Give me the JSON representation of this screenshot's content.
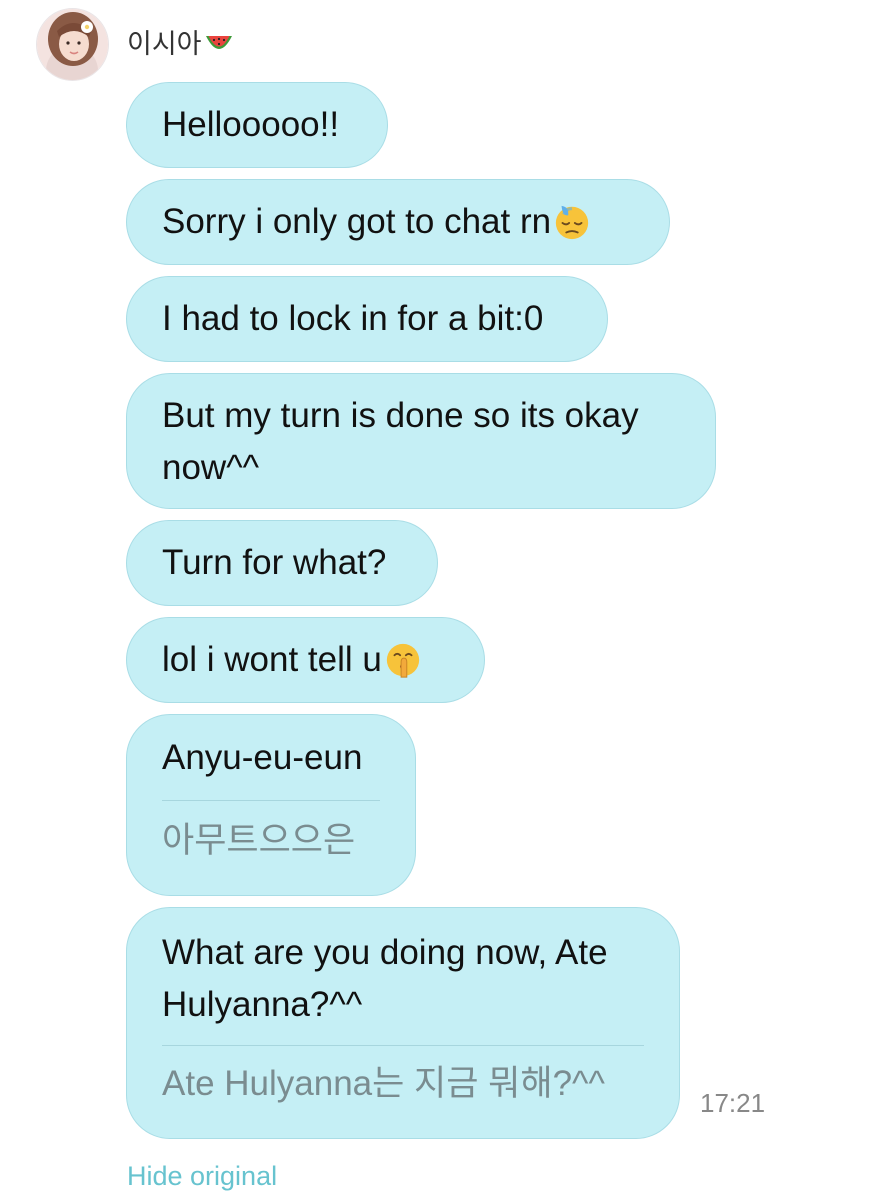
{
  "sender": {
    "name": "이시아",
    "name_emoji": "watermelon-icon"
  },
  "messages": [
    {
      "text": "Hellooooo!!"
    },
    {
      "text": "Sorry i only got to chat rn",
      "emoji": "downcast-sweat-face-icon"
    },
    {
      "text": "I had to lock in for a bit:0"
    },
    {
      "text": "But my turn is done so its okay now^^"
    },
    {
      "text": "Turn for what?"
    },
    {
      "text": "lol i wont tell u",
      "emoji": "shushing-face-icon"
    },
    {
      "text": "Anyu-eu-eun",
      "translation": "아무트으으은"
    },
    {
      "text": "What are you doing now, Ate Hulyanna?^^",
      "translation": "Ate Hulyanna는 지금 뭐해?^^"
    }
  ],
  "timestamp": "17:21",
  "hide_original_label": "Hide original",
  "colors": {
    "bubble_fill": "#c5eff5",
    "bubble_border": "#a9dde6",
    "translation_text": "#7a8c90",
    "link": "#67c3cf"
  }
}
